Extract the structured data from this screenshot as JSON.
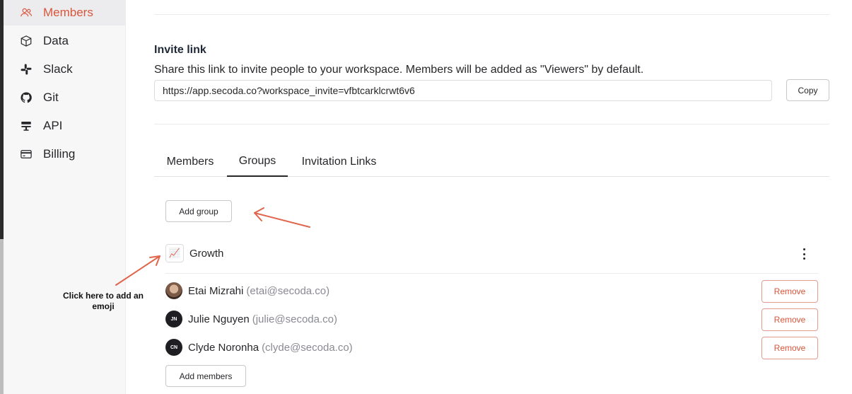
{
  "sidebar": {
    "items": [
      {
        "label": "Members",
        "icon": "users-icon",
        "active": true
      },
      {
        "label": "Data",
        "icon": "cube-icon",
        "active": false
      },
      {
        "label": "Slack",
        "icon": "slack-icon",
        "active": false
      },
      {
        "label": "Git",
        "icon": "github-icon",
        "active": false
      },
      {
        "label": "API",
        "icon": "api-icon",
        "active": false
      },
      {
        "label": "Billing",
        "icon": "credit-card-icon",
        "active": false
      }
    ]
  },
  "invite": {
    "title": "Invite link",
    "description": "Share this link to invite people to your workspace. Members will be added as \"Viewers\" by default.",
    "link": "https://app.secoda.co?workspace_invite=vfbtcarklcrwt6v6",
    "copy_label": "Copy"
  },
  "tabs": [
    {
      "label": "Members",
      "active": false
    },
    {
      "label": "Groups",
      "active": true
    },
    {
      "label": "Invitation Links",
      "active": false
    }
  ],
  "groups": {
    "add_group_label": "Add group",
    "group": {
      "emoji": "📈",
      "name": "Growth"
    },
    "members": [
      {
        "name": "Etai Mizrahi",
        "email": "(etai@secoda.co)",
        "initials": "",
        "remove_label": "Remove"
      },
      {
        "name": "Julie Nguyen",
        "email": "(julie@secoda.co)",
        "initials": "JN",
        "remove_label": "Remove"
      },
      {
        "name": "Clyde Noronha",
        "email": "(clyde@secoda.co)",
        "initials": "CN",
        "remove_label": "Remove"
      }
    ],
    "add_members_label": "Add members"
  },
  "annotation": {
    "text": "Click here to add an emoji"
  },
  "colors": {
    "accent": "#d9553c",
    "arrow": "#e0654b"
  }
}
